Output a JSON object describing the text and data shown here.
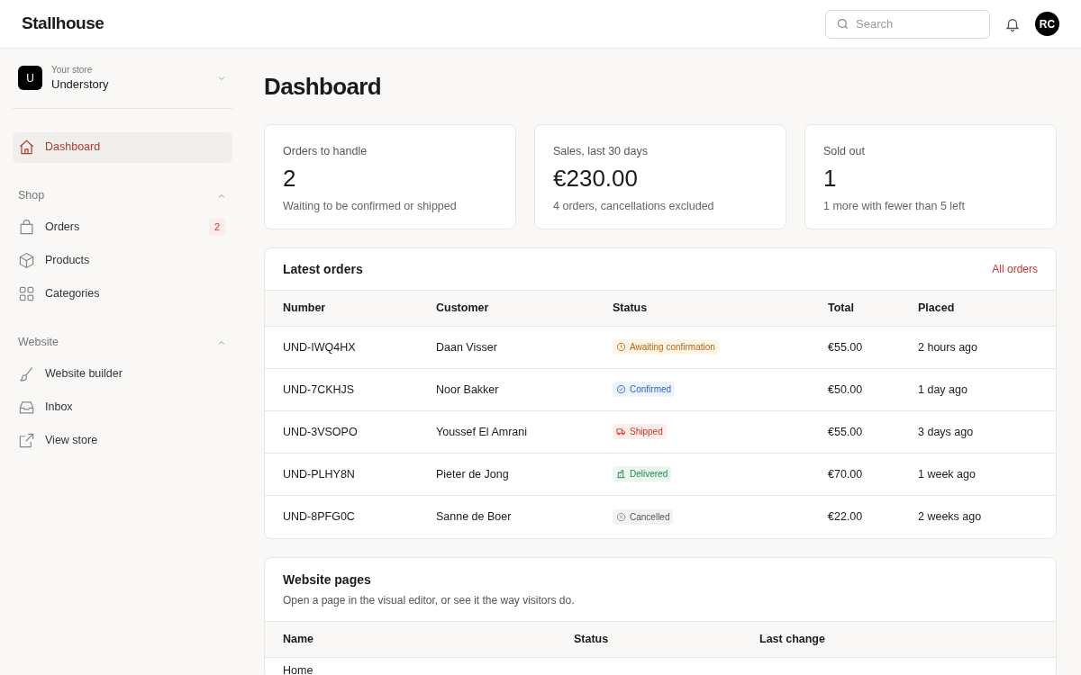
{
  "header": {
    "logo": "Stallhouse",
    "search": {
      "placeholder": "Search"
    },
    "avatar": "RC"
  },
  "store": {
    "initial": "U",
    "label": "Your store",
    "name": "Understory"
  },
  "sidebar": {
    "items": [
      {
        "label": "Dashboard",
        "kind": "home",
        "selected": true
      }
    ],
    "sections": [
      {
        "title": "Shop",
        "expanded": true,
        "items": [
          {
            "label": "Orders",
            "kind": "bag",
            "selected": false,
            "badge": "2"
          },
          {
            "label": "Products",
            "kind": "box",
            "selected": false
          },
          {
            "label": "Categories",
            "kind": "grid",
            "selected": false
          }
        ]
      },
      {
        "title": "Website",
        "expanded": true,
        "items": [
          {
            "label": "Website builder",
            "kind": "brush",
            "selected": false
          },
          {
            "label": "Inbox",
            "kind": "inbox",
            "selected": false
          },
          {
            "label": "View store",
            "kind": "external",
            "selected": false
          }
        ]
      }
    ]
  },
  "title": "Dashboard",
  "stats": [
    {
      "label": "Orders to handle",
      "value": "2",
      "note": "Waiting to be confirmed or shipped"
    },
    {
      "label": "Sales, last 30 days",
      "value": "€230.00",
      "note": "4 orders, cancellations excluded"
    },
    {
      "label": "Sold out",
      "value": "1",
      "note": "1 more with fewer than 5 left"
    }
  ],
  "orders": {
    "title": "Latest orders",
    "link": "All orders",
    "columns": [
      "Number",
      "Customer",
      "Status",
      "Total",
      "Placed"
    ],
    "rows": [
      {
        "number": "UND-IWQ4HX",
        "customer": "Daan Visser",
        "status": {
          "kind": "awaiting",
          "label": "Awaiting confirmation"
        },
        "total": "€55.00",
        "placed": "2 hours ago"
      },
      {
        "number": "UND-7CKHJS",
        "customer": "Noor Bakker",
        "status": {
          "kind": "confirmed",
          "label": "Confirmed"
        },
        "total": "€50.00",
        "placed": "1 day ago"
      },
      {
        "number": "UND-3VSOPO",
        "customer": "Youssef El Amrani",
        "status": {
          "kind": "shipped",
          "label": "Shipped"
        },
        "total": "€55.00",
        "placed": "3 days ago"
      },
      {
        "number": "UND-PLHY8N",
        "customer": "Pieter de Jong",
        "status": {
          "kind": "delivered",
          "label": "Delivered"
        },
        "total": "€70.00",
        "placed": "1 week ago"
      },
      {
        "number": "UND-8PFG0C",
        "customer": "Sanne de Boer",
        "status": {
          "kind": "cancelled",
          "label": "Cancelled"
        },
        "total": "€22.00",
        "placed": "2 weeks ago"
      }
    ]
  },
  "pages": {
    "title": "Website pages",
    "description": "Open a page in the visual editor, or see it the way visitors do.",
    "columns": [
      "Name",
      "Status",
      "Last change"
    ],
    "rows": [
      {
        "name": "Home"
      }
    ]
  }
}
